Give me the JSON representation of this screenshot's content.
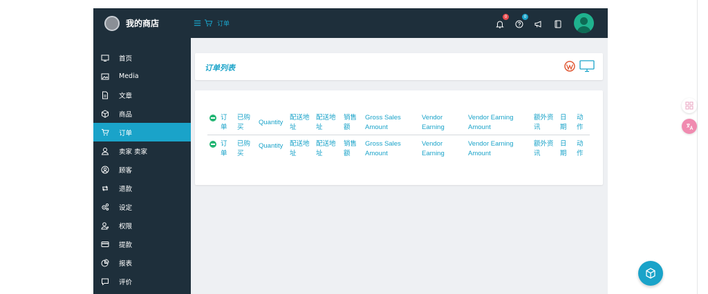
{
  "topbar": {
    "brand_name": "我的商店",
    "breadcrumb": "订单",
    "notifications_count": "0",
    "help_count": "0",
    "colors": {
      "bg": "#1e2f3b",
      "accent": "#1aa3c9",
      "badge_red": "#e84c4f"
    }
  },
  "sidebar": {
    "items": [
      {
        "label": "首页",
        "icon": "monitor-icon"
      },
      {
        "label": "Media",
        "icon": "image-icon"
      },
      {
        "label": "文章",
        "icon": "document-icon"
      },
      {
        "label": "商品",
        "icon": "box-icon"
      },
      {
        "label": "订单",
        "icon": "cart-icon",
        "active": true
      },
      {
        "label": "卖家 卖家",
        "icon": "user-icon"
      },
      {
        "label": "顾客",
        "icon": "customer-icon"
      },
      {
        "label": "退款",
        "icon": "refund-icon"
      },
      {
        "label": "设定",
        "icon": "settings-icon"
      },
      {
        "label": "权限",
        "icon": "user-remove-icon"
      },
      {
        "label": "提款",
        "icon": "card-icon"
      },
      {
        "label": "报表",
        "icon": "pie-chart-icon"
      },
      {
        "label": "评价",
        "icon": "comment-icon"
      }
    ]
  },
  "main": {
    "title": "订单列表",
    "table": {
      "rows": [
        [
          "订单",
          "已购买",
          "Quantity",
          "配送地址",
          "配送地址",
          "销售额",
          "Gross Sales Amount",
          "Vendor Earning",
          "Vendor Earning Amount",
          "额外资讯",
          "日期",
          "动作"
        ],
        [
          "订单",
          "已购买",
          "Quantity",
          "配送地址",
          "配送地址",
          "销售额",
          "Gross Sales Amount",
          "Vendor Earning",
          "Vendor Earning Amount",
          "额外资讯",
          "日期",
          "动作"
        ]
      ]
    }
  }
}
